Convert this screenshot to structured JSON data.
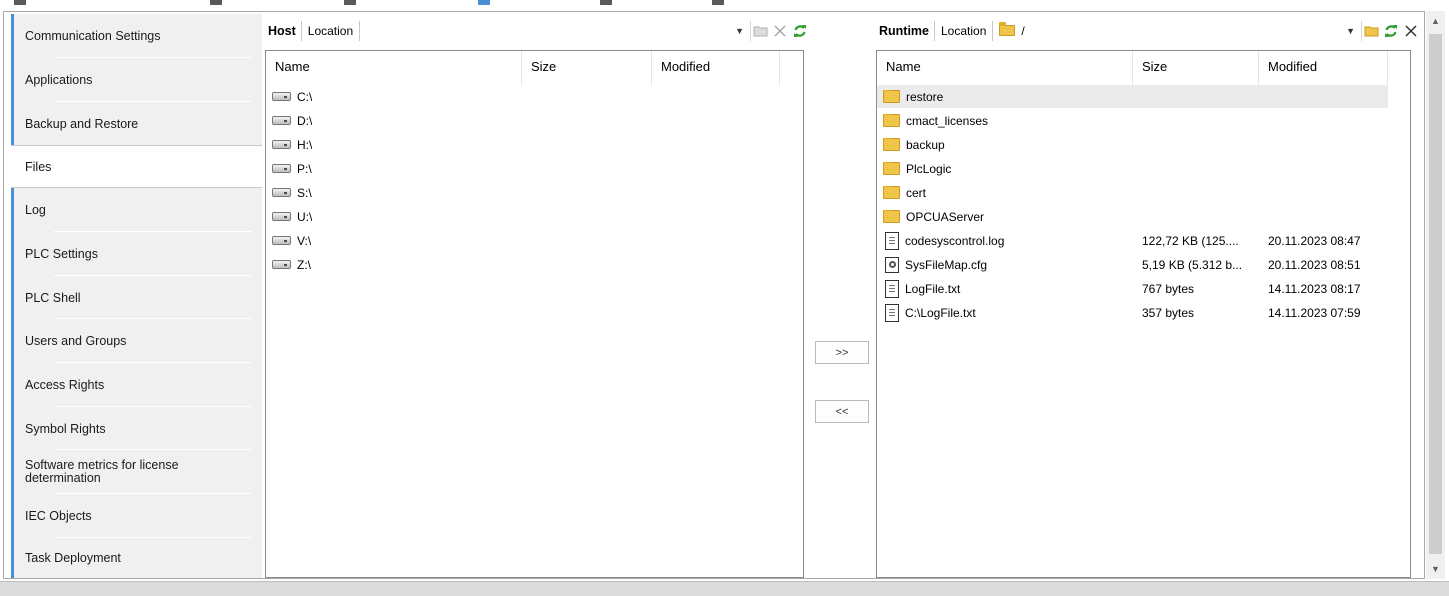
{
  "sidebar": {
    "items": [
      {
        "label": "Communication Settings"
      },
      {
        "label": "Applications"
      },
      {
        "label": "Backup and Restore"
      },
      {
        "label": "Files",
        "active": true
      },
      {
        "label": "Log"
      },
      {
        "label": "PLC Settings"
      },
      {
        "label": "PLC Shell"
      },
      {
        "label": "Users and Groups"
      },
      {
        "label": "Access Rights"
      },
      {
        "label": "Symbol Rights"
      },
      {
        "label": "Software metrics for license determination"
      },
      {
        "label": "IEC Objects"
      },
      {
        "label": "Task Deployment"
      }
    ]
  },
  "host": {
    "title": "Host",
    "location_label": "Location",
    "path": "",
    "columns": {
      "name": "Name",
      "size": "Size",
      "modified": "Modified"
    },
    "rows": [
      {
        "name": "C:\\"
      },
      {
        "name": "D:\\"
      },
      {
        "name": "H:\\"
      },
      {
        "name": "P:\\"
      },
      {
        "name": "S:\\"
      },
      {
        "name": "U:\\"
      },
      {
        "name": "V:\\"
      },
      {
        "name": "Z:\\"
      }
    ]
  },
  "runtime": {
    "title": "Runtime",
    "location_label": "Location",
    "path": "/",
    "columns": {
      "name": "Name",
      "size": "Size",
      "modified": "Modified"
    },
    "rows": [
      {
        "name": "restore",
        "type": "folder",
        "size": "",
        "modified": "",
        "selected": true
      },
      {
        "name": "cmact_licenses",
        "type": "folder",
        "size": "",
        "modified": ""
      },
      {
        "name": "backup",
        "type": "folder",
        "size": "",
        "modified": ""
      },
      {
        "name": "PlcLogic",
        "type": "folder",
        "size": "",
        "modified": ""
      },
      {
        "name": "cert",
        "type": "folder",
        "size": "",
        "modified": ""
      },
      {
        "name": "OPCUAServer",
        "type": "folder",
        "size": "",
        "modified": ""
      },
      {
        "name": "codesyscontrol.log",
        "type": "file",
        "size": "122,72 KB (125....",
        "modified": "20.11.2023 08:47"
      },
      {
        "name": "SysFileMap.cfg",
        "type": "cfg",
        "size": "5,19 KB (5.312 b...",
        "modified": "20.11.2023 08:51"
      },
      {
        "name": "LogFile.txt",
        "type": "file",
        "size": "767 bytes",
        "modified": "14.11.2023 08:17"
      },
      {
        "name": "C:\\LogFile.txt",
        "type": "file",
        "size": "357 bytes",
        "modified": "14.11.2023 07:59"
      }
    ]
  },
  "transfer": {
    "to_runtime": ">>",
    "to_host": "<<"
  },
  "colors": {
    "accent": "#4a90d9",
    "refresh": "#2f9e2f",
    "folder": "#f0c54a"
  }
}
